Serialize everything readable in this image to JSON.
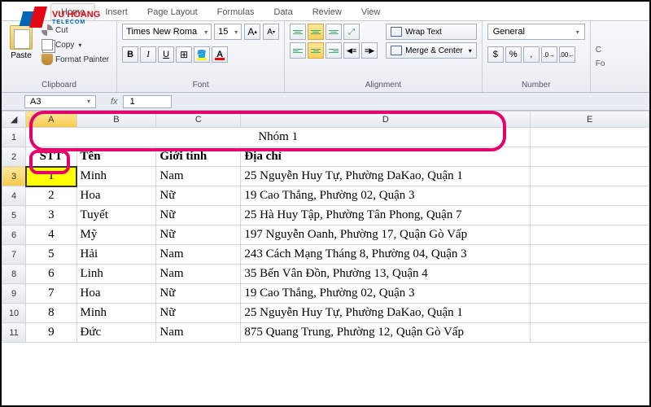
{
  "logo": {
    "brand": "VU HOANG",
    "sub": "TELECOM"
  },
  "tabs": [
    "Home",
    "Insert",
    "Page Layout",
    "Formulas",
    "Data",
    "Review",
    "View"
  ],
  "active_tab": 0,
  "ribbon": {
    "clipboard": {
      "paste": "Paste",
      "cut": "Cut",
      "copy": "Copy",
      "painter": "Format Painter",
      "label": "Clipboard"
    },
    "font": {
      "name": "Times New Roma",
      "size": "15",
      "label": "Font"
    },
    "alignment": {
      "wrap": "Wrap Text",
      "merge": "Merge & Center",
      "label": "Alignment"
    },
    "number": {
      "format": "General",
      "label": "Number"
    },
    "right": {
      "cond": "C",
      "format": "Fo"
    }
  },
  "namebox": "A3",
  "formula": "1",
  "columns": [
    "A",
    "B",
    "C",
    "D",
    "E"
  ],
  "title": "Nhóm 1",
  "headers": {
    "stt": "STT",
    "ten": "Tên",
    "gioitinh": "Giới tính",
    "diachi": "Địa chỉ"
  },
  "rows": [
    {
      "n": "3",
      "stt": "1",
      "ten": "Minh",
      "gt": "Nam",
      "dc": "25 Nguyễn Huy Tự, Phường DaKao, Quận 1"
    },
    {
      "n": "4",
      "stt": "2",
      "ten": "Hoa",
      "gt": "Nữ",
      "dc": "19 Cao Thắng, Phường 02, Quận 3"
    },
    {
      "n": "5",
      "stt": "3",
      "ten": "Tuyết",
      "gt": "Nữ",
      "dc": "25 Hà Huy Tập, Phường Tân Phong, Quận 7"
    },
    {
      "n": "6",
      "stt": "4",
      "ten": "Mỹ",
      "gt": "Nữ",
      "dc": "197 Nguyễn Oanh, Phường 17, Quận Gò Vấp"
    },
    {
      "n": "7",
      "stt": "5",
      "ten": "Hải",
      "gt": "Nam",
      "dc": "243 Cách Mạng Tháng 8, Phường 04, Quận 3"
    },
    {
      "n": "8",
      "stt": "6",
      "ten": "Linh",
      "gt": "Nam",
      "dc": "35 Bến Vân Đồn, Phường 13, Quận 4"
    },
    {
      "n": "9",
      "stt": "7",
      "ten": "Hoa",
      "gt": "Nữ",
      "dc": "19 Cao Thắng, Phường 02, Quận 3"
    },
    {
      "n": "10",
      "stt": "8",
      "ten": "Minh",
      "gt": "Nữ",
      "dc": "25 Nguyễn Huy Tự, Phường DaKao, Quận 1"
    },
    {
      "n": "11",
      "stt": "9",
      "ten": "Đức",
      "gt": "Nam",
      "dc": "875 Quang Trung, Phường 12, Quận Gò Vấp"
    }
  ]
}
